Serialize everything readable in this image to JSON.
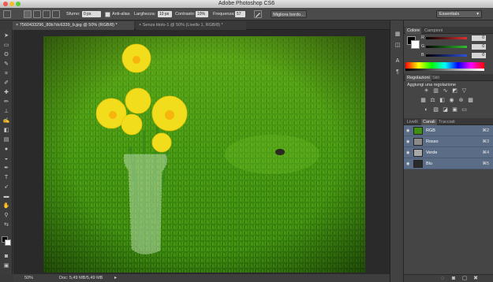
{
  "window": {
    "title": "Adobe Photoshop CS6"
  },
  "options_bar": {
    "sfumo_label": "Sfumo:",
    "sfumo_value": "0 px",
    "antialias_label": "Anti-alias",
    "larghezza_label": "Larghezza:",
    "larghezza_value": "10 px",
    "contrasto_label": "Contrasto:",
    "contrasto_value": "10%",
    "frequenza_label": "Frequenza:",
    "frequenza_value": "57",
    "refine_edge_button": "Migliora bordo...",
    "workspace_select": "Essentials"
  },
  "doc_tabs": [
    {
      "label": "7560433296_80b7dc6339_b.jpg @ 50% (RGB/8) *",
      "close": "×"
    },
    {
      "label": "Senza titolo-1 @ 50% (Livello 1, RGB/8) *",
      "close": "×"
    }
  ],
  "status_bar": {
    "zoom": "50%",
    "doc_info": "Doc: 5,49 MB/5,49 MB"
  },
  "color_panel": {
    "tabs": [
      "Colore",
      "Campioni"
    ],
    "channels": [
      {
        "label": "R",
        "value": "0",
        "color": "#e03030"
      },
      {
        "label": "G",
        "value": "0",
        "color": "#30c030"
      },
      {
        "label": "B",
        "value": "0",
        "color": "#3050e0"
      }
    ]
  },
  "adjustments_panel": {
    "tabs": [
      "Regolazioni",
      "Stili"
    ],
    "heading": "Aggiungi una regolazione"
  },
  "layers_panel": {
    "tabs": [
      "Livelli",
      "Canali",
      "Tracciati"
    ],
    "rows": [
      {
        "name": "RGB",
        "key": "⌘2"
      },
      {
        "name": "Rosso",
        "key": "⌘3"
      },
      {
        "name": "Verde",
        "key": "⌘4"
      },
      {
        "name": "Blu",
        "key": "⌘5"
      }
    ]
  },
  "colors": {
    "accent_selection": "#5b6d86",
    "grass": "#3f9c12",
    "flower": "#f2dd1c"
  }
}
